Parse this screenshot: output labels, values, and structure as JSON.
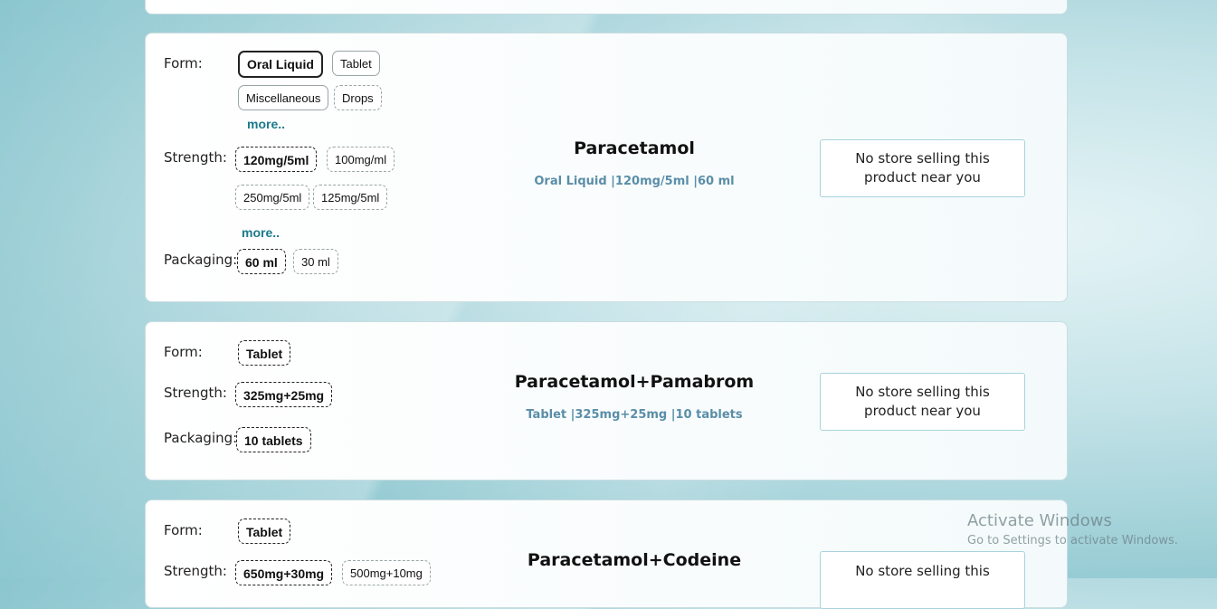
{
  "labels": {
    "form": "Form:",
    "strength": "Strength:",
    "packaging": "Packaging:",
    "more": "more.."
  },
  "cards": [
    {
      "title": "Paracetamol",
      "subtitle": "Oral Liquid |120mg/5ml |60 ml",
      "forms": [
        "Oral Liquid",
        "Tablet",
        "Miscellaneous",
        "Drops"
      ],
      "strengths": [
        "120mg/5ml",
        "100mg/ml",
        "250mg/5ml",
        "125mg/5ml"
      ],
      "packaging": [
        "60 ml",
        "30 ml"
      ],
      "store_status": "No store selling this product near you"
    },
    {
      "title": "Paracetamol+Pamabrom",
      "subtitle": "Tablet |325mg+25mg |10 tablets",
      "forms": [
        "Tablet"
      ],
      "strengths": [
        "325mg+25mg"
      ],
      "packaging": [
        "10 tablets"
      ],
      "store_status": "No store selling this product near you"
    },
    {
      "title": "Paracetamol+Codeine",
      "forms": [
        "Tablet"
      ],
      "strengths": [
        "650mg+30mg",
        "500mg+10mg"
      ],
      "store_status": "No store selling this"
    }
  ],
  "windows_watermark": {
    "title": "Activate Windows",
    "subtitle": "Go to Settings to activate Windows."
  }
}
